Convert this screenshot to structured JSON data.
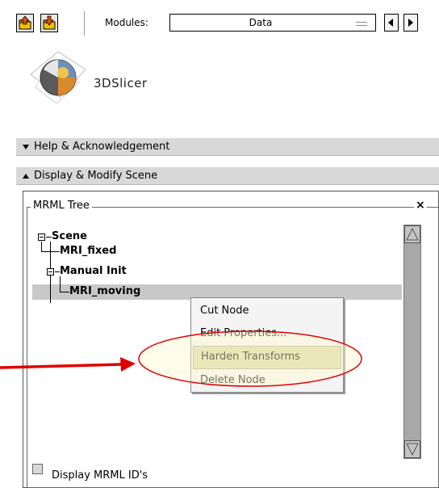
{
  "toolbar": {
    "modules_label": "Modules:",
    "module_selected": "Data"
  },
  "logo": {
    "text": "3DSlicer"
  },
  "sections": {
    "help": {
      "label": "Help & Acknowledgement",
      "expanded": false
    },
    "display": {
      "label": "Display & Modify Scene",
      "expanded": true
    }
  },
  "mrml_tree": {
    "group_label": "MRML Tree",
    "close_symbol": "×",
    "nodes": [
      {
        "label": "Scene"
      },
      {
        "label": "MRI_fixed"
      },
      {
        "label": "Manual Init"
      },
      {
        "label": "MRI_moving",
        "selected": true
      }
    ]
  },
  "context_menu": {
    "items": [
      {
        "label": "Cut Node"
      },
      {
        "label": "Edit Properties..."
      },
      {
        "label": "Harden Transforms",
        "active": true
      },
      {
        "label": "Delete Node"
      }
    ]
  },
  "display_ids": {
    "label": "Display MRML ID's",
    "checked": false
  },
  "colors": {
    "callout_arrow": "#e00000",
    "highlight_ellipse_stroke": "#e00000",
    "highlight_ellipse_fill": "#fffbd0",
    "selected_row": "#c8c8c8",
    "section_header": "#d8d8d8"
  }
}
